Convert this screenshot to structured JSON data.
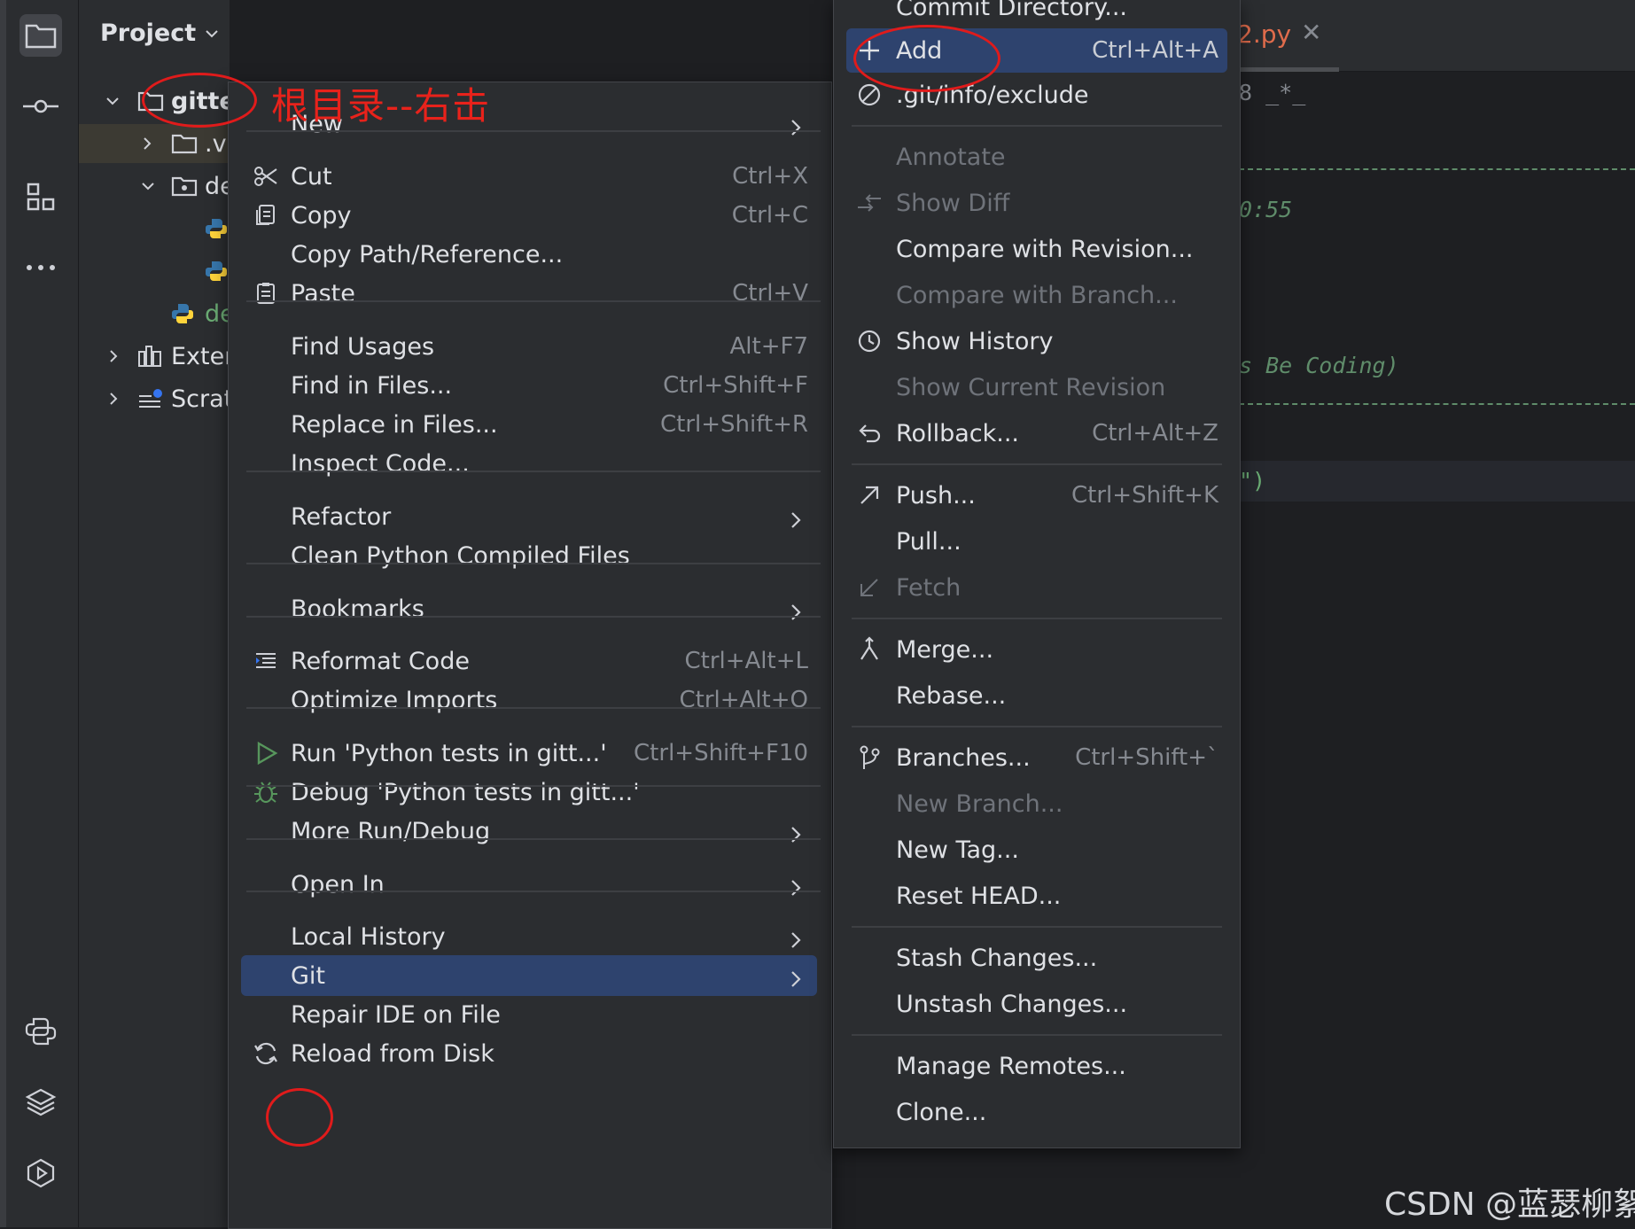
{
  "project_panel": {
    "title": "Project",
    "tree": [
      {
        "label": "gitte"
      },
      {
        "label": ".v"
      },
      {
        "label": "de"
      },
      {
        "label": "de"
      },
      {
        "label": "Exter"
      },
      {
        "label": "Scrat"
      }
    ]
  },
  "annotation": {
    "text": "根目录--右击"
  },
  "editor": {
    "tab_label": "2.py",
    "code": [
      "8 _*_",
      "0:55",
      "s Be Coding)",
      "\")"
    ]
  },
  "context_menu": {
    "items": [
      {
        "label": "New",
        "shortcut": "",
        "submenu": true
      },
      {
        "label": "Cut",
        "shortcut": "Ctrl+X",
        "icon": "scissors-icon"
      },
      {
        "label": "Copy",
        "shortcut": "Ctrl+C",
        "icon": "copy-icon"
      },
      {
        "label": "Copy Path/Reference...",
        "shortcut": ""
      },
      {
        "label": "Paste",
        "shortcut": "Ctrl+V",
        "icon": "paste-icon"
      },
      {
        "label": "Find Usages",
        "shortcut": "Alt+F7"
      },
      {
        "label": "Find in Files...",
        "shortcut": "Ctrl+Shift+F"
      },
      {
        "label": "Replace in Files...",
        "shortcut": "Ctrl+Shift+R"
      },
      {
        "label": "Inspect Code...",
        "shortcut": ""
      },
      {
        "label": "Refactor",
        "shortcut": "",
        "submenu": true
      },
      {
        "label": "Clean Python Compiled Files",
        "shortcut": ""
      },
      {
        "label": "Bookmarks",
        "shortcut": "",
        "submenu": true
      },
      {
        "label": "Reformat Code",
        "shortcut": "Ctrl+Alt+L",
        "icon": "reformat-icon"
      },
      {
        "label": "Optimize Imports",
        "shortcut": "Ctrl+Alt+O"
      },
      {
        "label": "Run 'Python tests in gitt...'",
        "shortcut": "Ctrl+Shift+F10",
        "icon": "run-icon"
      },
      {
        "label": "Debug 'Python tests in gitt...'",
        "shortcut": "",
        "icon": "debug-bug-icon"
      },
      {
        "label": "More Run/Debug",
        "shortcut": "",
        "submenu": true
      },
      {
        "label": "Open In",
        "shortcut": "",
        "submenu": true
      },
      {
        "label": "Local History",
        "shortcut": "",
        "submenu": true
      },
      {
        "label": "Git",
        "shortcut": "",
        "submenu": true,
        "highlighted": true
      },
      {
        "label": "Repair IDE on File",
        "shortcut": ""
      },
      {
        "label": "Reload from Disk",
        "shortcut": "",
        "icon": "reload-icon"
      }
    ]
  },
  "git_menu": {
    "items": [
      {
        "label": "Commit Directory...",
        "shortcut": ""
      },
      {
        "label": "Add",
        "shortcut": "Ctrl+Alt+A",
        "icon": "plus-icon",
        "highlighted": true
      },
      {
        "label": ".git/info/exclude",
        "shortcut": "",
        "icon": "ignore-icon"
      },
      {
        "label": "Annotate",
        "shortcut": "",
        "disabled": true
      },
      {
        "label": "Show Diff",
        "shortcut": "",
        "disabled": true,
        "icon": "diff-icon"
      },
      {
        "label": "Compare with Revision...",
        "shortcut": ""
      },
      {
        "label": "Compare with Branch...",
        "shortcut": "",
        "disabled": true
      },
      {
        "label": "Show History",
        "shortcut": "",
        "icon": "clock-icon"
      },
      {
        "label": "Show Current Revision",
        "shortcut": "",
        "disabled": true
      },
      {
        "label": "Rollback...",
        "shortcut": "Ctrl+Alt+Z",
        "icon": "rollback-icon"
      },
      {
        "label": "Push...",
        "shortcut": "Ctrl+Shift+K",
        "icon": "push-arrow-icon"
      },
      {
        "label": "Pull...",
        "shortcut": ""
      },
      {
        "label": "Fetch",
        "shortcut": "",
        "disabled": true,
        "icon": "fetch-arrow-icon"
      },
      {
        "label": "Merge...",
        "shortcut": "",
        "icon": "merge-icon"
      },
      {
        "label": "Rebase...",
        "shortcut": ""
      },
      {
        "label": "Branches...",
        "shortcut": "Ctrl+Shift+`",
        "icon": "branch-icon"
      },
      {
        "label": "New Branch...",
        "shortcut": "",
        "disabled": true
      },
      {
        "label": "New Tag...",
        "shortcut": ""
      },
      {
        "label": "Reset HEAD...",
        "shortcut": ""
      },
      {
        "label": "Stash Changes...",
        "shortcut": ""
      },
      {
        "label": "Unstash Changes...",
        "shortcut": ""
      },
      {
        "label": "Manage Remotes...",
        "shortcut": ""
      },
      {
        "label": "Clone...",
        "shortcut": ""
      }
    ]
  },
  "watermark": {
    "text": "CSDN @蓝瑟柳絮"
  },
  "colors": {
    "accent": "#2e436e",
    "annotation_red": "#e01b1b",
    "python_blue": "#3776ab",
    "python_yellow": "#ffd43b"
  }
}
